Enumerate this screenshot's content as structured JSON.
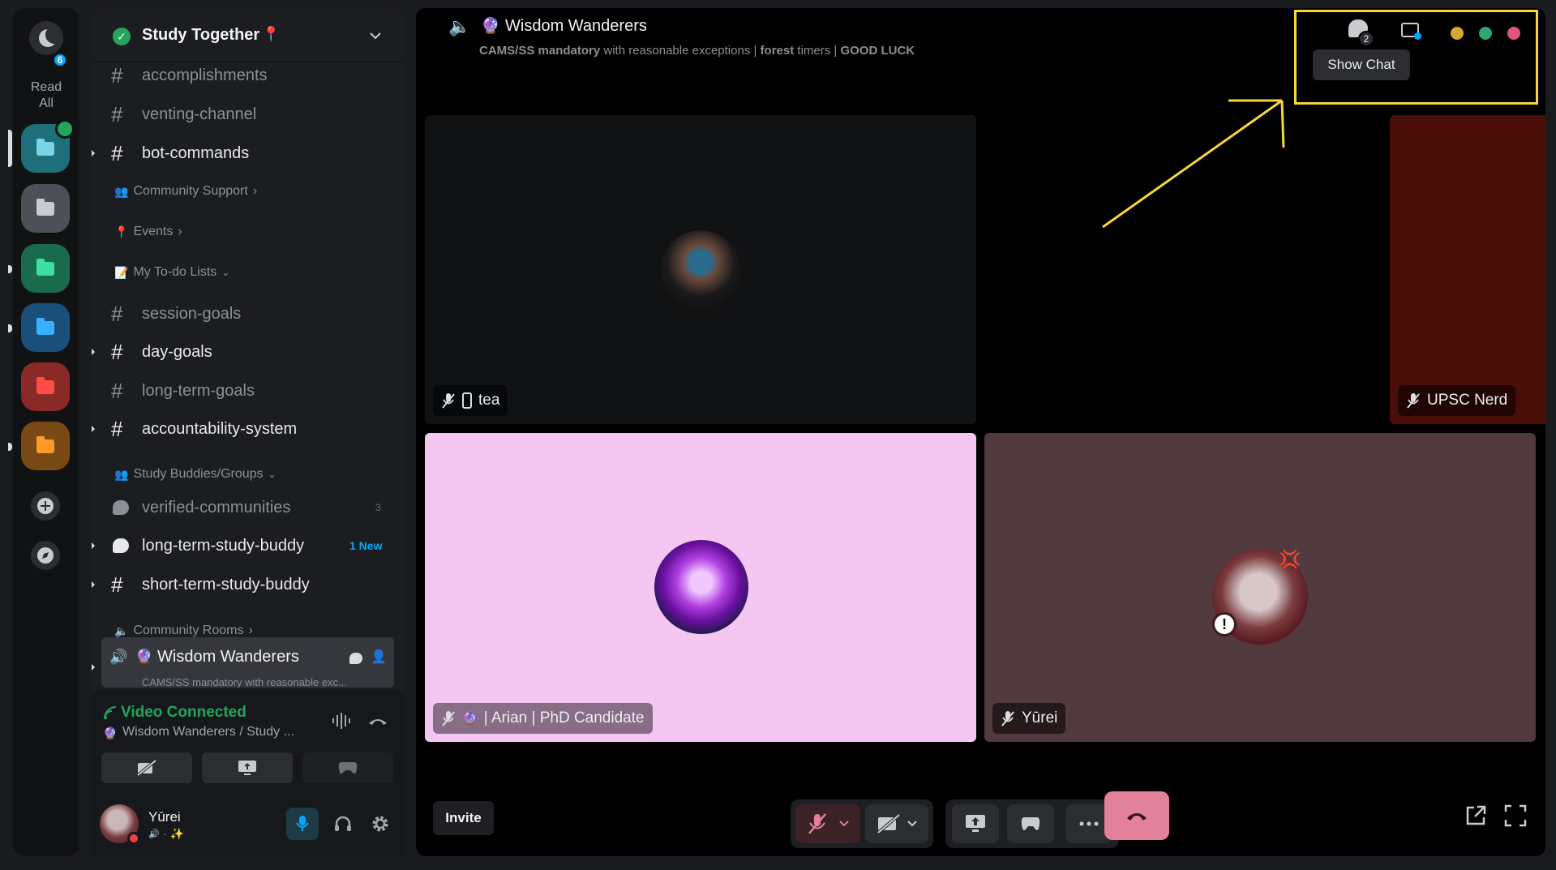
{
  "rail": {
    "read_all_label": "Read All",
    "read_all_badge": "6"
  },
  "server": {
    "name": "Study Together",
    "name_emoji": "📍"
  },
  "channels": {
    "accomplishments": "accomplishments",
    "venting": "venting-channel",
    "bot_commands": "bot-commands",
    "cat_community_support": "Community Support",
    "cat_events": "Events",
    "cat_todo": "My To-do Lists",
    "session_goals": "session-goals",
    "day_goals": "day-goals",
    "long_term_goals": "long-term-goals",
    "accountability": "accountability-system",
    "cat_study_buddies": "Study Buddies/Groups",
    "verified_communities": "verified-communities",
    "verified_count": "3",
    "long_term_buddy": "long-term-study-buddy",
    "long_term_buddy_badge": "1 New",
    "short_term_buddy": "short-term-study-buddy",
    "cat_community_rooms": "Community Rooms",
    "active_voice": "Wisdom Wanderers",
    "active_voice_sub": "CAMS/SS mandatory with reasonable exc..."
  },
  "voice_panel": {
    "status": "Video Connected",
    "location": "Wisdom Wanderers / Study ..."
  },
  "user": {
    "name": "Yūrei",
    "status": "· ✨"
  },
  "call": {
    "channel_name": "Wisdom Wanderers",
    "topic_bold_1": "CAMS/SS mandatory",
    "topic_text_1": " with reasonable exceptions | ",
    "topic_bold_2": "forest",
    "topic_text_2": " timers | ",
    "topic_bold_3": "GOOD LUCK",
    "chat_badge": "2",
    "tooltip": "Show Chat",
    "invite_label": "Invite"
  },
  "participants": [
    {
      "name": "tea",
      "bg": "#111214"
    },
    {
      "name": "UPSC Nerd",
      "bg": "#4a0e08"
    },
    {
      "name": "| Arian | PhD Candidate",
      "bg": "#f6c6f2"
    },
    {
      "name": "Yūrei",
      "bg": "#513a3d"
    }
  ],
  "colors": {
    "green": "#23a55a",
    "accent_blue": "#00a8fc",
    "hangup": "#e2819a",
    "annotation": "#f5d63d"
  }
}
